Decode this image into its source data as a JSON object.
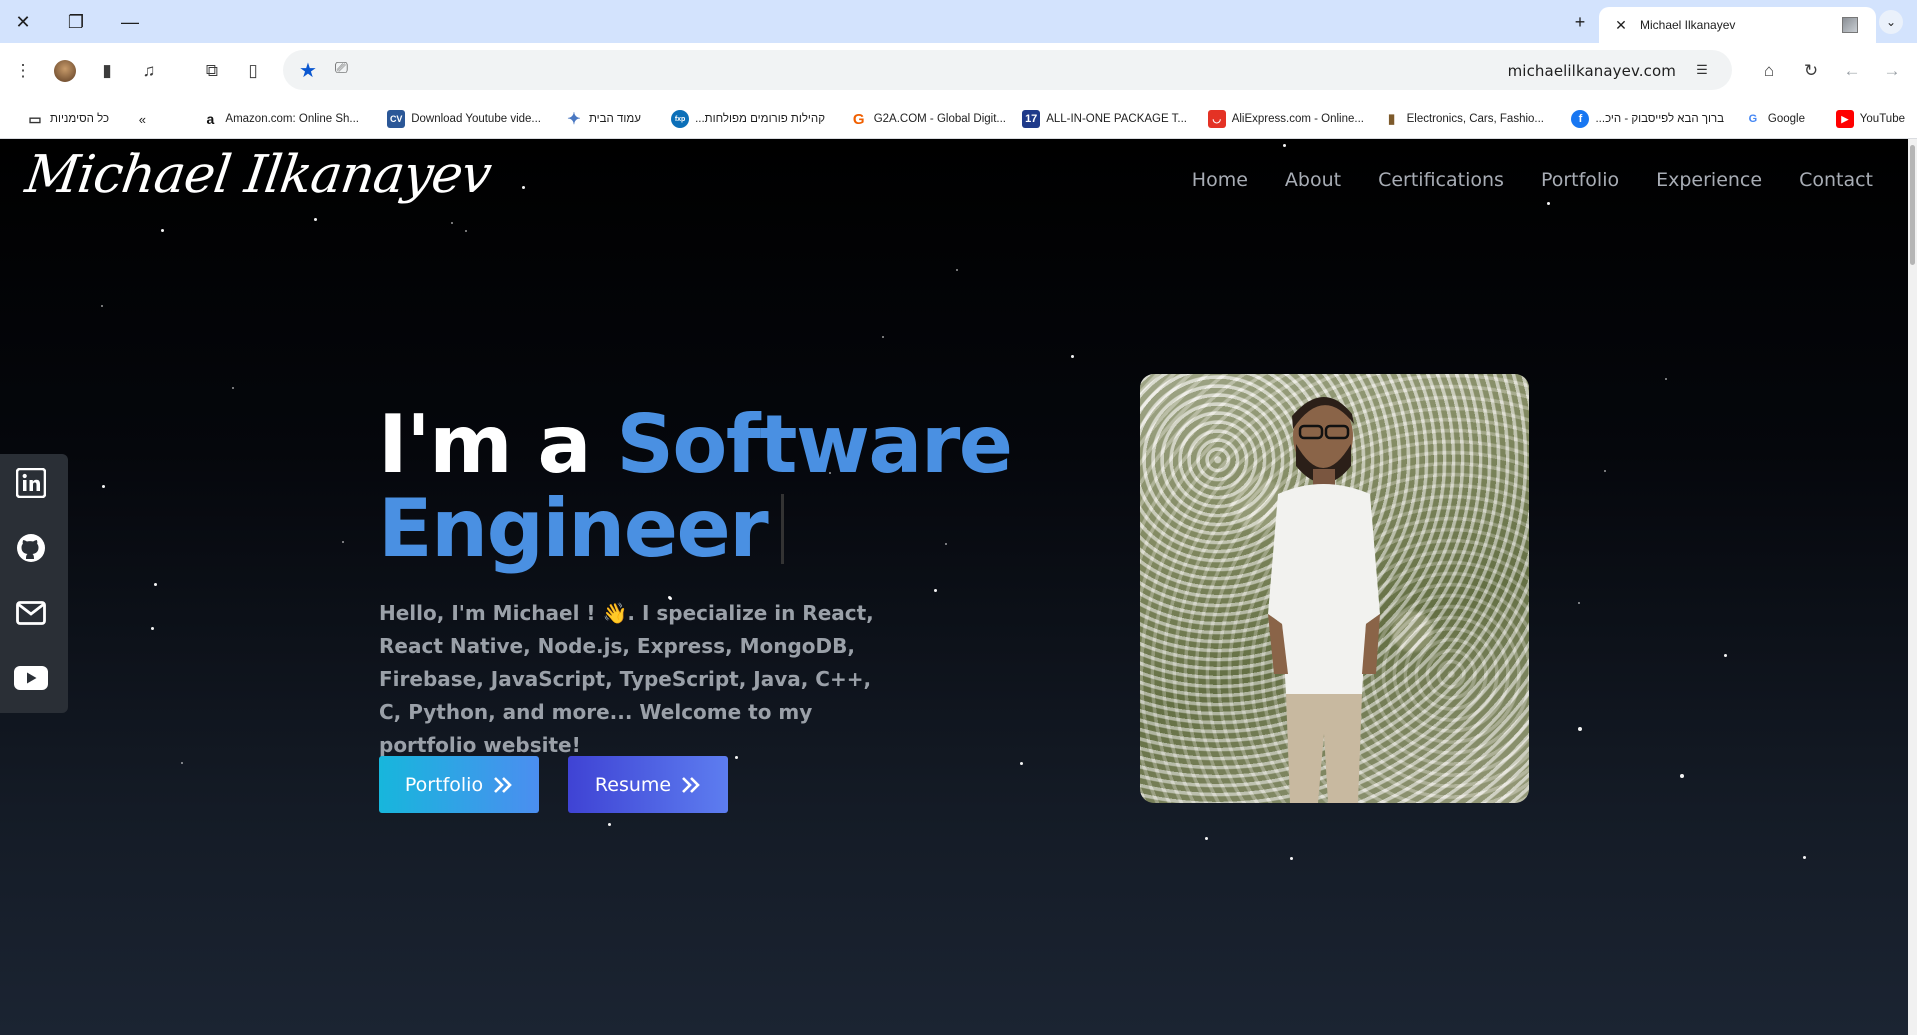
{
  "browser": {
    "tab_title": "Michael Ilkanayev",
    "url": "michaelilkanayev.com",
    "bookmarks": [
      {
        "label": "YouTube",
        "icon": "youtube-icon"
      },
      {
        "label": "Google",
        "icon": "google-icon"
      },
      {
        "label": "...ברוך הבא לפייסבוק - היכ",
        "icon": "facebook-icon"
      },
      {
        "label": "Electronics, Cars, Fashio...",
        "icon": "ebay-icon"
      },
      {
        "label": "AliExpress.com - Online...",
        "icon": "aliexpress-icon"
      },
      {
        "label": "ALL-IN-ONE PACKAGE T...",
        "icon": "seventeen-icon"
      },
      {
        "label": "G2A.COM - Global Digit...",
        "icon": "g2a-icon"
      },
      {
        "label": "...קהילות פורומים מפולחות",
        "icon": "fxp-icon"
      },
      {
        "label": "עמוד הבית",
        "icon": "sparkle-icon"
      },
      {
        "label": "Download Youtube vide...",
        "icon": "cv-icon"
      },
      {
        "label": "Amazon.com: Online Sh...",
        "icon": "amazon-icon"
      }
    ],
    "all_bookmarks_label": "כל הסימניות",
    "fav_text": {
      "cv": "CV",
      "seventeen": "17",
      "fxp": "fxp",
      "amazon": "a",
      "google": "G",
      "g2a": "G"
    }
  },
  "site": {
    "logo": "Michael Ilkanayev",
    "nav": [
      "Home",
      "About",
      "Certifications",
      "Portfolio",
      "Experience",
      "Contact"
    ],
    "hero": {
      "title_prefix": "I'm a ",
      "title_accent_1": "Software",
      "title_accent_2": "Engineer",
      "intro": "Hello, I'm Michael ! 👋. I specialize in React, React Native, Node.js, Express, MongoDB, Firebase, JavaScript, TypeScript, Java, C++, C, Python, and more... Welcome to my portfolio website!",
      "buttons": {
        "portfolio": "Portfolio",
        "resume": "Resume"
      }
    },
    "social": [
      "linkedin-icon",
      "github-icon",
      "mail-icon",
      "youtube-icon"
    ]
  },
  "colors": {
    "accent": "#4a90e2",
    "portfolio_btn": "#17b6dc",
    "resume_btn": "#3f43d4",
    "nav_text": "#a8adb5"
  }
}
